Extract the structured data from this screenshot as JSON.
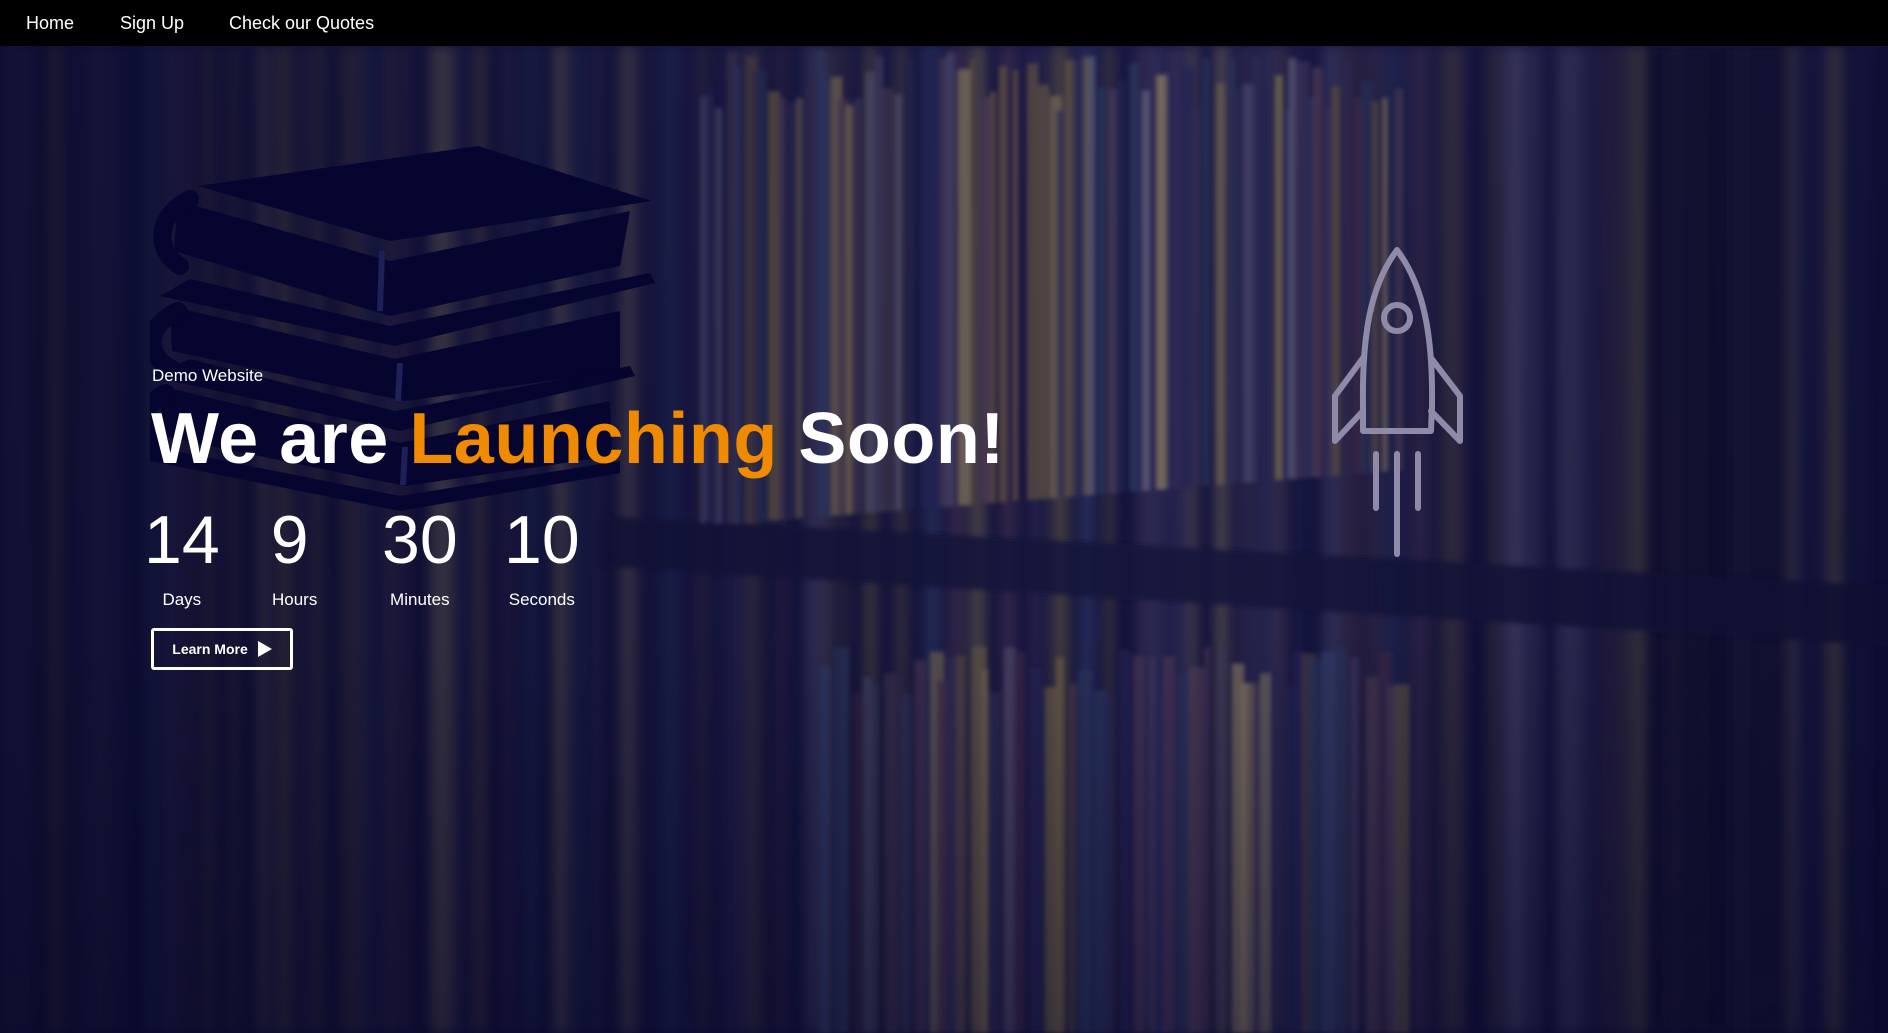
{
  "nav": {
    "items": [
      {
        "label": "Home"
      },
      {
        "label": "Sign Up"
      },
      {
        "label": "Check our Quotes"
      }
    ]
  },
  "hero": {
    "eyebrow": "Demo Website",
    "headline": {
      "before": "We are",
      "accent": "Launching",
      "after": "Soon!"
    },
    "countdown": [
      {
        "value": "14",
        "label": "Days"
      },
      {
        "value": "9",
        "label": "Hours"
      },
      {
        "value": "30",
        "label": "Minutes"
      },
      {
        "value": "10",
        "label": "Seconds"
      }
    ],
    "cta_label": "Learn More"
  },
  "icons": {
    "books": "books-icon",
    "rocket": "rocket-icon",
    "play": "play-icon"
  },
  "colors": {
    "accent": "#f08a00",
    "navbar": "#000000",
    "overlay": "#0b0b2e",
    "text": "#ffffff"
  }
}
